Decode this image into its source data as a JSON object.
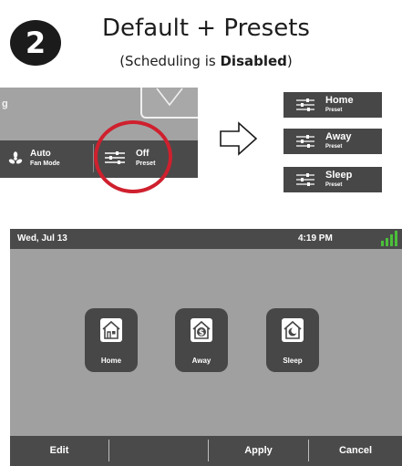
{
  "header": {
    "step_number": "2",
    "title": "Default + Presets",
    "subtitle_prefix": "(Scheduling is ",
    "subtitle_bold": "Disabled",
    "subtitle_suffix": ")"
  },
  "snippet": {
    "partial_letter": "g",
    "fan_mode": {
      "value": "Auto",
      "label": "Fan Mode",
      "icon": "fan-icon"
    },
    "preset": {
      "value": "Off",
      "label": "Preset",
      "icon": "sliders-icon"
    },
    "highlight_color": "#cf202e"
  },
  "transition_icon": "right-arrow-icon",
  "preset_options": [
    {
      "name": "Home",
      "label": "Preset",
      "icon": "sliders-icon"
    },
    {
      "name": "Away",
      "label": "Preset",
      "icon": "sliders-icon"
    },
    {
      "name": "Sleep",
      "label": "Preset",
      "icon": "sliders-icon"
    }
  ],
  "thermostat_screen": {
    "status_bar": {
      "date": "Wed, Jul 13",
      "time": "4:19 PM",
      "signal_icon": "signal-strength-icon",
      "signal_color": "#4bbf3a"
    },
    "preset_tiles": [
      {
        "label": "Home",
        "icon": "house-home-icon"
      },
      {
        "label": "Away",
        "icon": "house-dollar-icon"
      },
      {
        "label": "Sleep",
        "icon": "house-moon-icon"
      }
    ],
    "bottom_bar": {
      "edit_label": "Edit",
      "apply_label": "Apply",
      "cancel_label": "Cancel"
    }
  }
}
